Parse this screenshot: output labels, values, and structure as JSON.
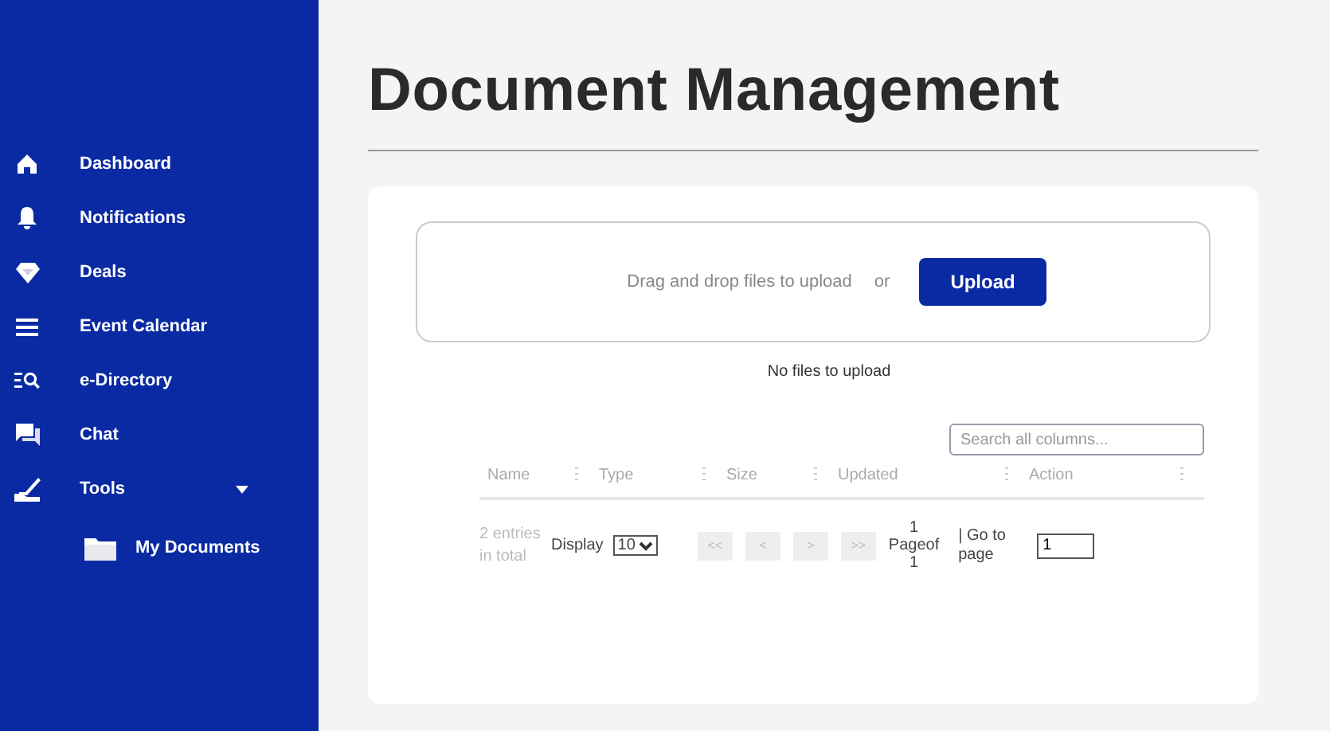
{
  "sidebar": {
    "items": [
      {
        "label": "Dashboard"
      },
      {
        "label": "Notifications"
      },
      {
        "label": "Deals"
      },
      {
        "label": "Event Calendar"
      },
      {
        "label": "e-Directory"
      },
      {
        "label": "Chat"
      },
      {
        "label": "Tools",
        "expanded": true,
        "children": [
          {
            "label": "My Documents"
          }
        ]
      }
    ]
  },
  "page": {
    "title": "Document Management"
  },
  "upload": {
    "prompt": "Drag and drop files to upload",
    "or": "or",
    "button": "Upload",
    "status": "No files to upload"
  },
  "table": {
    "search": {
      "placeholder": "Search all columns..."
    },
    "columns": [
      "Name",
      "Type",
      "Size",
      "Updated",
      "Action"
    ],
    "footer": {
      "entries": "2 entries in total",
      "display_label": "Display",
      "page_size": "10",
      "pager": [
        {
          "label": "<<",
          "disabled": true
        },
        {
          "label": "<",
          "disabled": true
        },
        {
          "label": ">",
          "disabled": true
        },
        {
          "label": ">>",
          "disabled": true
        }
      ],
      "page_label": "Page",
      "current": "1",
      "of_label": "of",
      "total": "1",
      "goto_label": "| Go to page",
      "goto_value": "1"
    }
  }
}
